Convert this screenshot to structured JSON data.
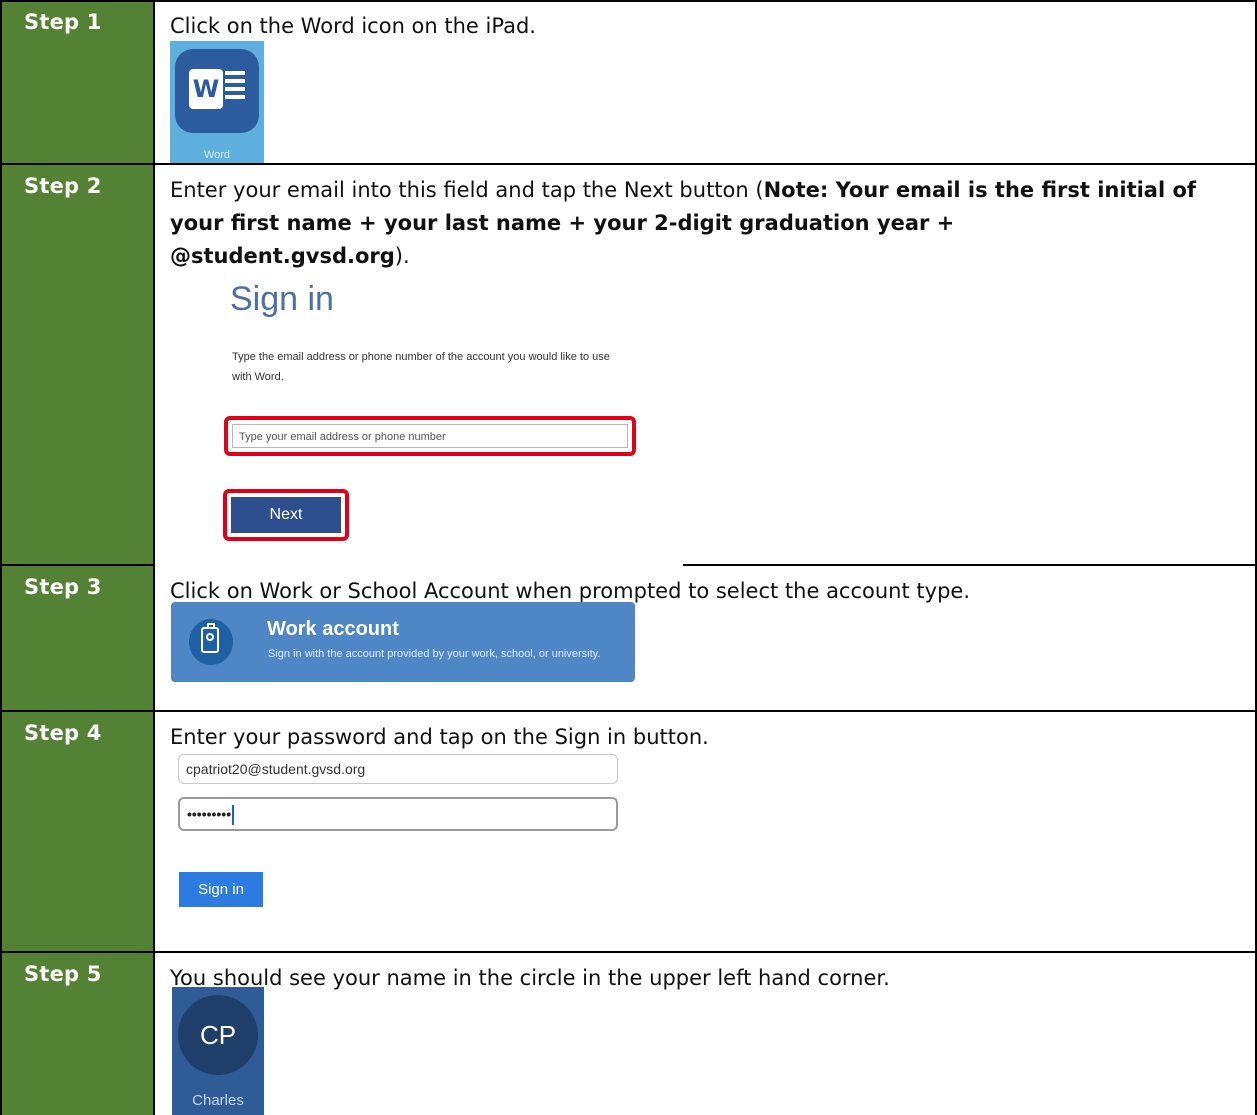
{
  "steps": [
    {
      "label": "Step 1",
      "instruction": "Click on the Word icon on the iPad."
    },
    {
      "label": "Step 2",
      "instruction_pre": "Enter your email into this field and tap the Next button (",
      "instruction_bold": "Note: Your email is the first initial of your first name + your last name + your 2-digit graduation year + @student.gvsd.org",
      "instruction_post": ")."
    },
    {
      "label": "Step 3",
      "instruction": "Click on Work or School Account when prompted to select the account type."
    },
    {
      "label": "Step 4",
      "instruction": "Enter your password and tap on the Sign in button."
    },
    {
      "label": "Step 5",
      "instruction": "You should see your name in the circle in the upper left hand corner."
    }
  ],
  "word_icon": {
    "letter": "W",
    "caption": "Word"
  },
  "signin": {
    "title": "Sign in",
    "description": "Type the email address or phone number of the account you would like to use with Word.",
    "email_placeholder": "Type your email address or phone number",
    "next_label": "Next"
  },
  "work_account": {
    "title": "Work account",
    "description": "Sign in with the account provided by your work, school, or university."
  },
  "login": {
    "email_value": "cpatriot20@student.gvsd.org",
    "password_mask": "•••••••••",
    "signin_label": "Sign in"
  },
  "profile": {
    "initials": "CP",
    "name": "Charles"
  },
  "colors": {
    "step_green": "#548235",
    "accent_red": "#e0001a",
    "word_blue": "#2c5c9e"
  }
}
